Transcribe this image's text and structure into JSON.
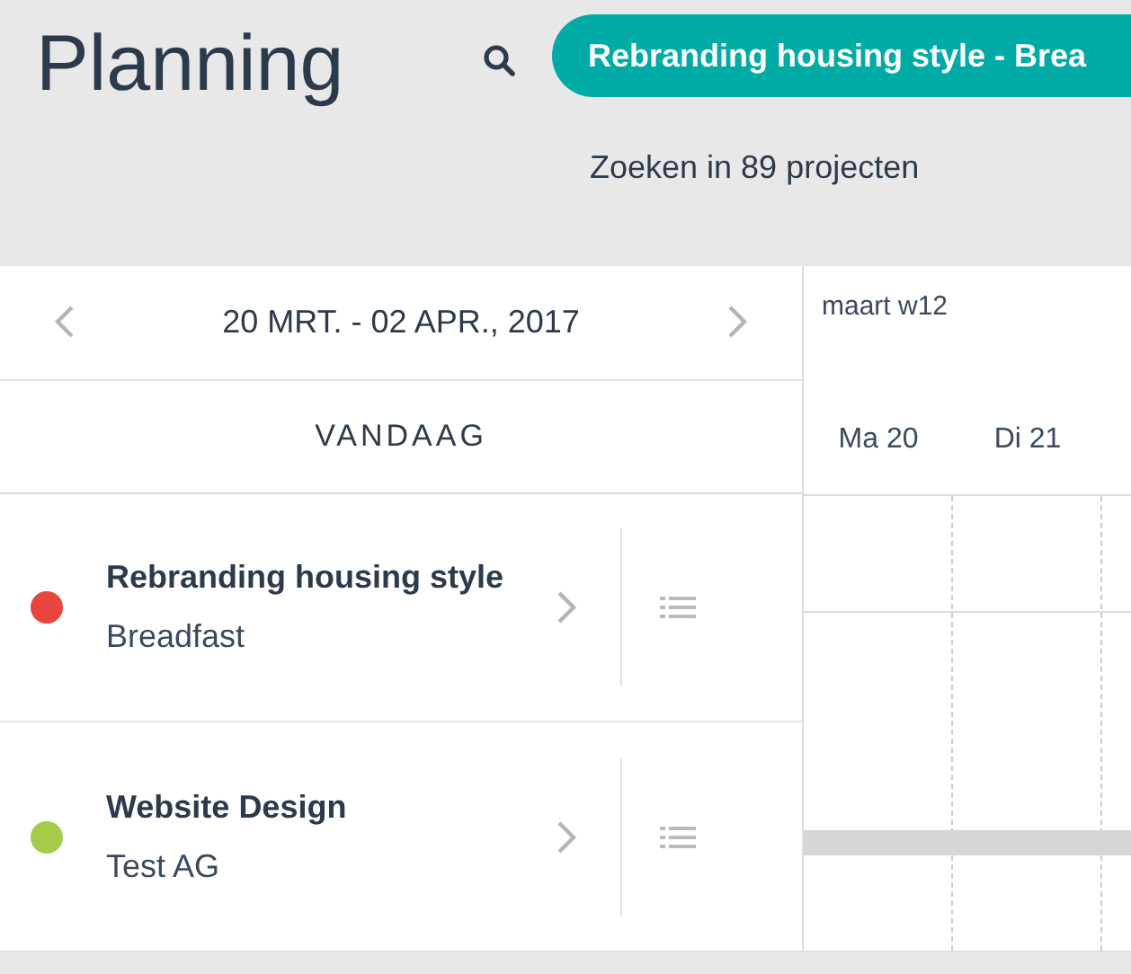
{
  "header": {
    "title": "Planning",
    "search_chip": "Rebranding housing style - Brea",
    "search_hint": "Zoeken in 89 projecten"
  },
  "date_nav": {
    "range": "20 MRT. - 02 APR., 2017",
    "today": "VANDAAG"
  },
  "timeline": {
    "week": "maart w12",
    "days": [
      "Ma 20",
      "Di 21"
    ]
  },
  "projects": [
    {
      "name": "Rebranding housing style",
      "client": "Breadfast",
      "color": "#e8453c"
    },
    {
      "name": "Website Design",
      "client": "Test AG",
      "color": "#a4cc4a"
    }
  ]
}
